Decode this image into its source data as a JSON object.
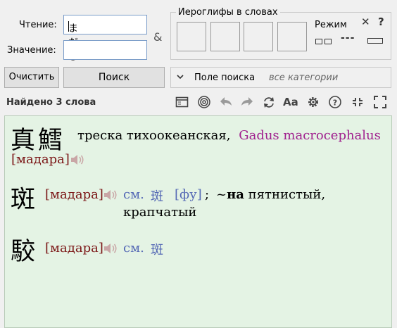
{
  "search": {
    "reading_label": "Чтение:",
    "reading_value": "まだら",
    "meaning_label": "Значение:",
    "meaning_value": "",
    "amp": "&",
    "clear_label": "Очистить",
    "search_label": "Поиск"
  },
  "kanji_box": {
    "title": "Иероглифы в словах",
    "mode_label": "Режим",
    "close": "✕",
    "help": "?",
    "mode_dash": "---"
  },
  "field": {
    "label": "Поле поиска",
    "value": "все категории"
  },
  "status": {
    "found": "Найдено 3 слова"
  },
  "toolbar": {
    "icons": [
      "window-icon",
      "spiral-icon",
      "undo-icon",
      "redo-icon",
      "refresh-icon",
      "font-icon",
      "gear-icon",
      "help-icon",
      "collapse-icon",
      "expand-icon"
    ],
    "font_text": "Aa"
  },
  "results": [
    {
      "kanji": "真鱈",
      "reading": "[мадара]",
      "meaning": "треска тихоокеанская,",
      "latin": "Gadus macrocephalus"
    },
    {
      "kanji": "斑",
      "reading": "[мадара]",
      "see": "см.",
      "see_kanji": "斑",
      "see_reading": "[фу]",
      "sep": ";",
      "tilde": "~",
      "bold": "на",
      "meaning1": "пятнистый,",
      "meaning2": "крапчатый"
    },
    {
      "kanji": "駮",
      "reading": "[мадара]",
      "see": "см.",
      "see_kanji": "斑"
    }
  ],
  "colors": {
    "results_bg": "#e4f3e4",
    "reading": "#7b1616",
    "reference": "#5569b5",
    "latin": "#a0208e"
  }
}
